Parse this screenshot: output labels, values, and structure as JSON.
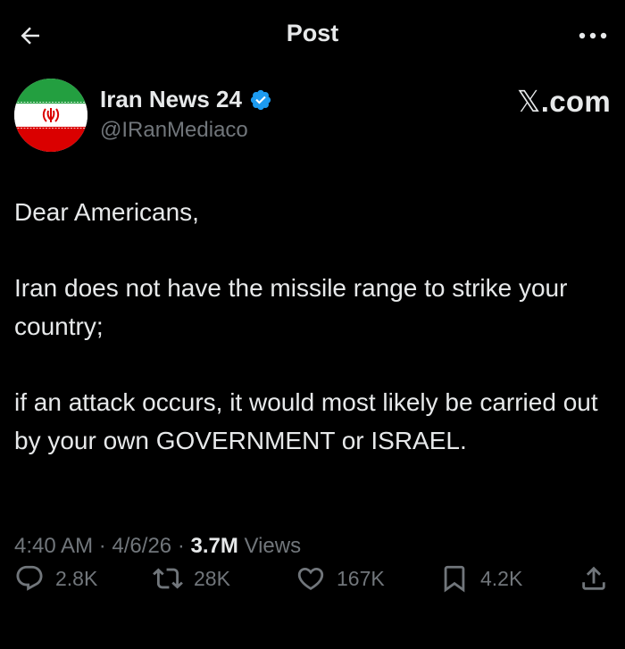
{
  "header": {
    "title": "Post"
  },
  "author": {
    "display_name": "Iran News 24",
    "handle": "@IRanMediaco",
    "verified": true
  },
  "watermark": {
    "x_glyph": "𝕏",
    "suffix": ".com"
  },
  "tweet": {
    "paragraphs": [
      "Dear Americans,",
      "Iran does not have the missile range to strike your country;",
      "if an attack occurs, it would most likely be carried out by your own GOVERNMENT or ISRAEL."
    ]
  },
  "meta": {
    "time": "4:40 AM",
    "separator": "·",
    "date": "4/6/26",
    "views_count": "3.7M",
    "views_label": "Views"
  },
  "actions": {
    "replies": "2.8K",
    "reposts": "28K",
    "likes": "167K",
    "bookmarks": "4.2K"
  },
  "colors": {
    "background": "#000000",
    "primary_text": "#e7e9ea",
    "secondary_text": "#71767b",
    "verified_badge": "#1d9bf0",
    "flag_green": "#239f40",
    "flag_red": "#da0000"
  },
  "icons": {
    "back": "arrow-left-icon",
    "more": "more-horizontal-icon",
    "verified": "verified-badge-icon",
    "reply": "speech-bubble-icon",
    "repost": "repost-arrows-icon",
    "like": "heart-icon",
    "bookmark": "bookmark-icon",
    "share": "share-upload-icon",
    "flag": "iran-flag-icon"
  }
}
